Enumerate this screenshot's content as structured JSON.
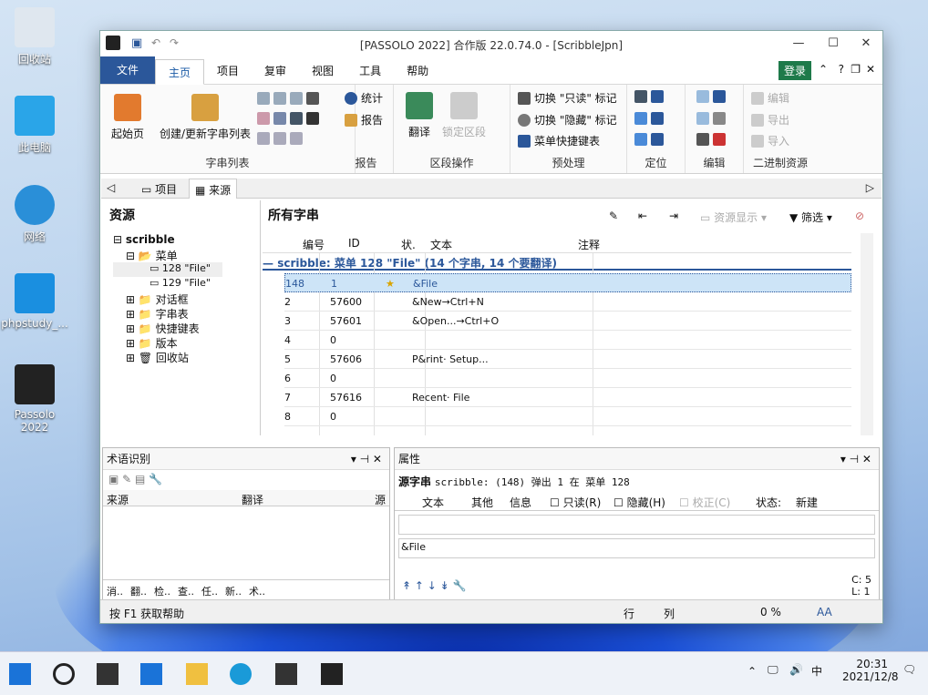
{
  "desktop": {
    "icons": [
      "回收站",
      "此电脑",
      "网络",
      "phpstudy_...",
      "Passolo\n2022"
    ]
  },
  "window": {
    "title": "[PASSOLO 2022] 合作版 22.0.74.0 - [ScribbleJpn]",
    "login": "登录"
  },
  "tabs": [
    "文件",
    "主页",
    "项目",
    "复审",
    "视图",
    "工具",
    "帮助"
  ],
  "ribbon": {
    "groups": [
      "字串列表",
      "报告",
      "区段操作",
      "预处理",
      "定位",
      "编辑",
      "二进制资源"
    ],
    "home": "起始页",
    "create": "创建/更新字串列表",
    "stats": "统计",
    "report": "报告",
    "translate": "翻译",
    "lock": "锁定区段",
    "readonly": "切换 \"只读\" 标记",
    "hidden": "切换 \"隐藏\" 标记",
    "shortcut": "菜单快捷键表",
    "edit": "编辑",
    "export": "导出",
    "import": "导入"
  },
  "doctabs": [
    "项目",
    "来源"
  ],
  "left": {
    "title": "资源",
    "tree": [
      "scribble",
      "菜单",
      "128 \"File\"",
      "129 \"File\"",
      "对话框",
      "字串表",
      "快捷键表",
      "版本",
      "回收站"
    ]
  },
  "main": {
    "title": "所有字串",
    "resview": "资源显示",
    "filter": "筛选",
    "columns": [
      "编号",
      "ID",
      "状.",
      "文本",
      "注释"
    ],
    "group": "scribble: 菜单 128 \"File\" (14 个字串, 14 个要翻译)",
    "rows": [
      [
        "148",
        "1",
        "&File"
      ],
      [
        "2",
        "57600",
        "&New→Ctrl+N"
      ],
      [
        "3",
        "57601",
        "&Open...→Ctrl+O"
      ],
      [
        "4",
        "0",
        ""
      ],
      [
        "5",
        "57606",
        "P&rint· Setup..."
      ],
      [
        "6",
        "0",
        ""
      ],
      [
        "7",
        "57616",
        "Recent· File"
      ],
      [
        "8",
        "0",
        ""
      ]
    ]
  },
  "term": {
    "title": "术语识别",
    "col1": "来源",
    "col2": "翻译",
    "col3": "源",
    "tabs": [
      "消..",
      "翻..",
      "检..",
      "查..",
      "任..",
      "新..",
      "术.."
    ]
  },
  "props": {
    "title": "属性",
    "src": "源字串",
    "srcval": "scribble: (148) 弹出 1 在 菜单 128",
    "tabs": [
      "文本",
      "其他",
      "信息"
    ],
    "readonly": "只读(R)",
    "hiddenbox": "隐藏(H)",
    "verify": "校正(C)",
    "state": "状态:",
    "stateval": "新建",
    "text": "&File",
    "c": "C:",
    "cval": "5",
    "l": "L:",
    "lval": "1"
  },
  "status": {
    "help": "按 F1 获取帮助",
    "row": "行",
    "col": "列",
    "pct": "0 %",
    "aa": "AA"
  },
  "clock": {
    "time": "20:31",
    "date": "2021/12/8",
    "ime": "中"
  }
}
